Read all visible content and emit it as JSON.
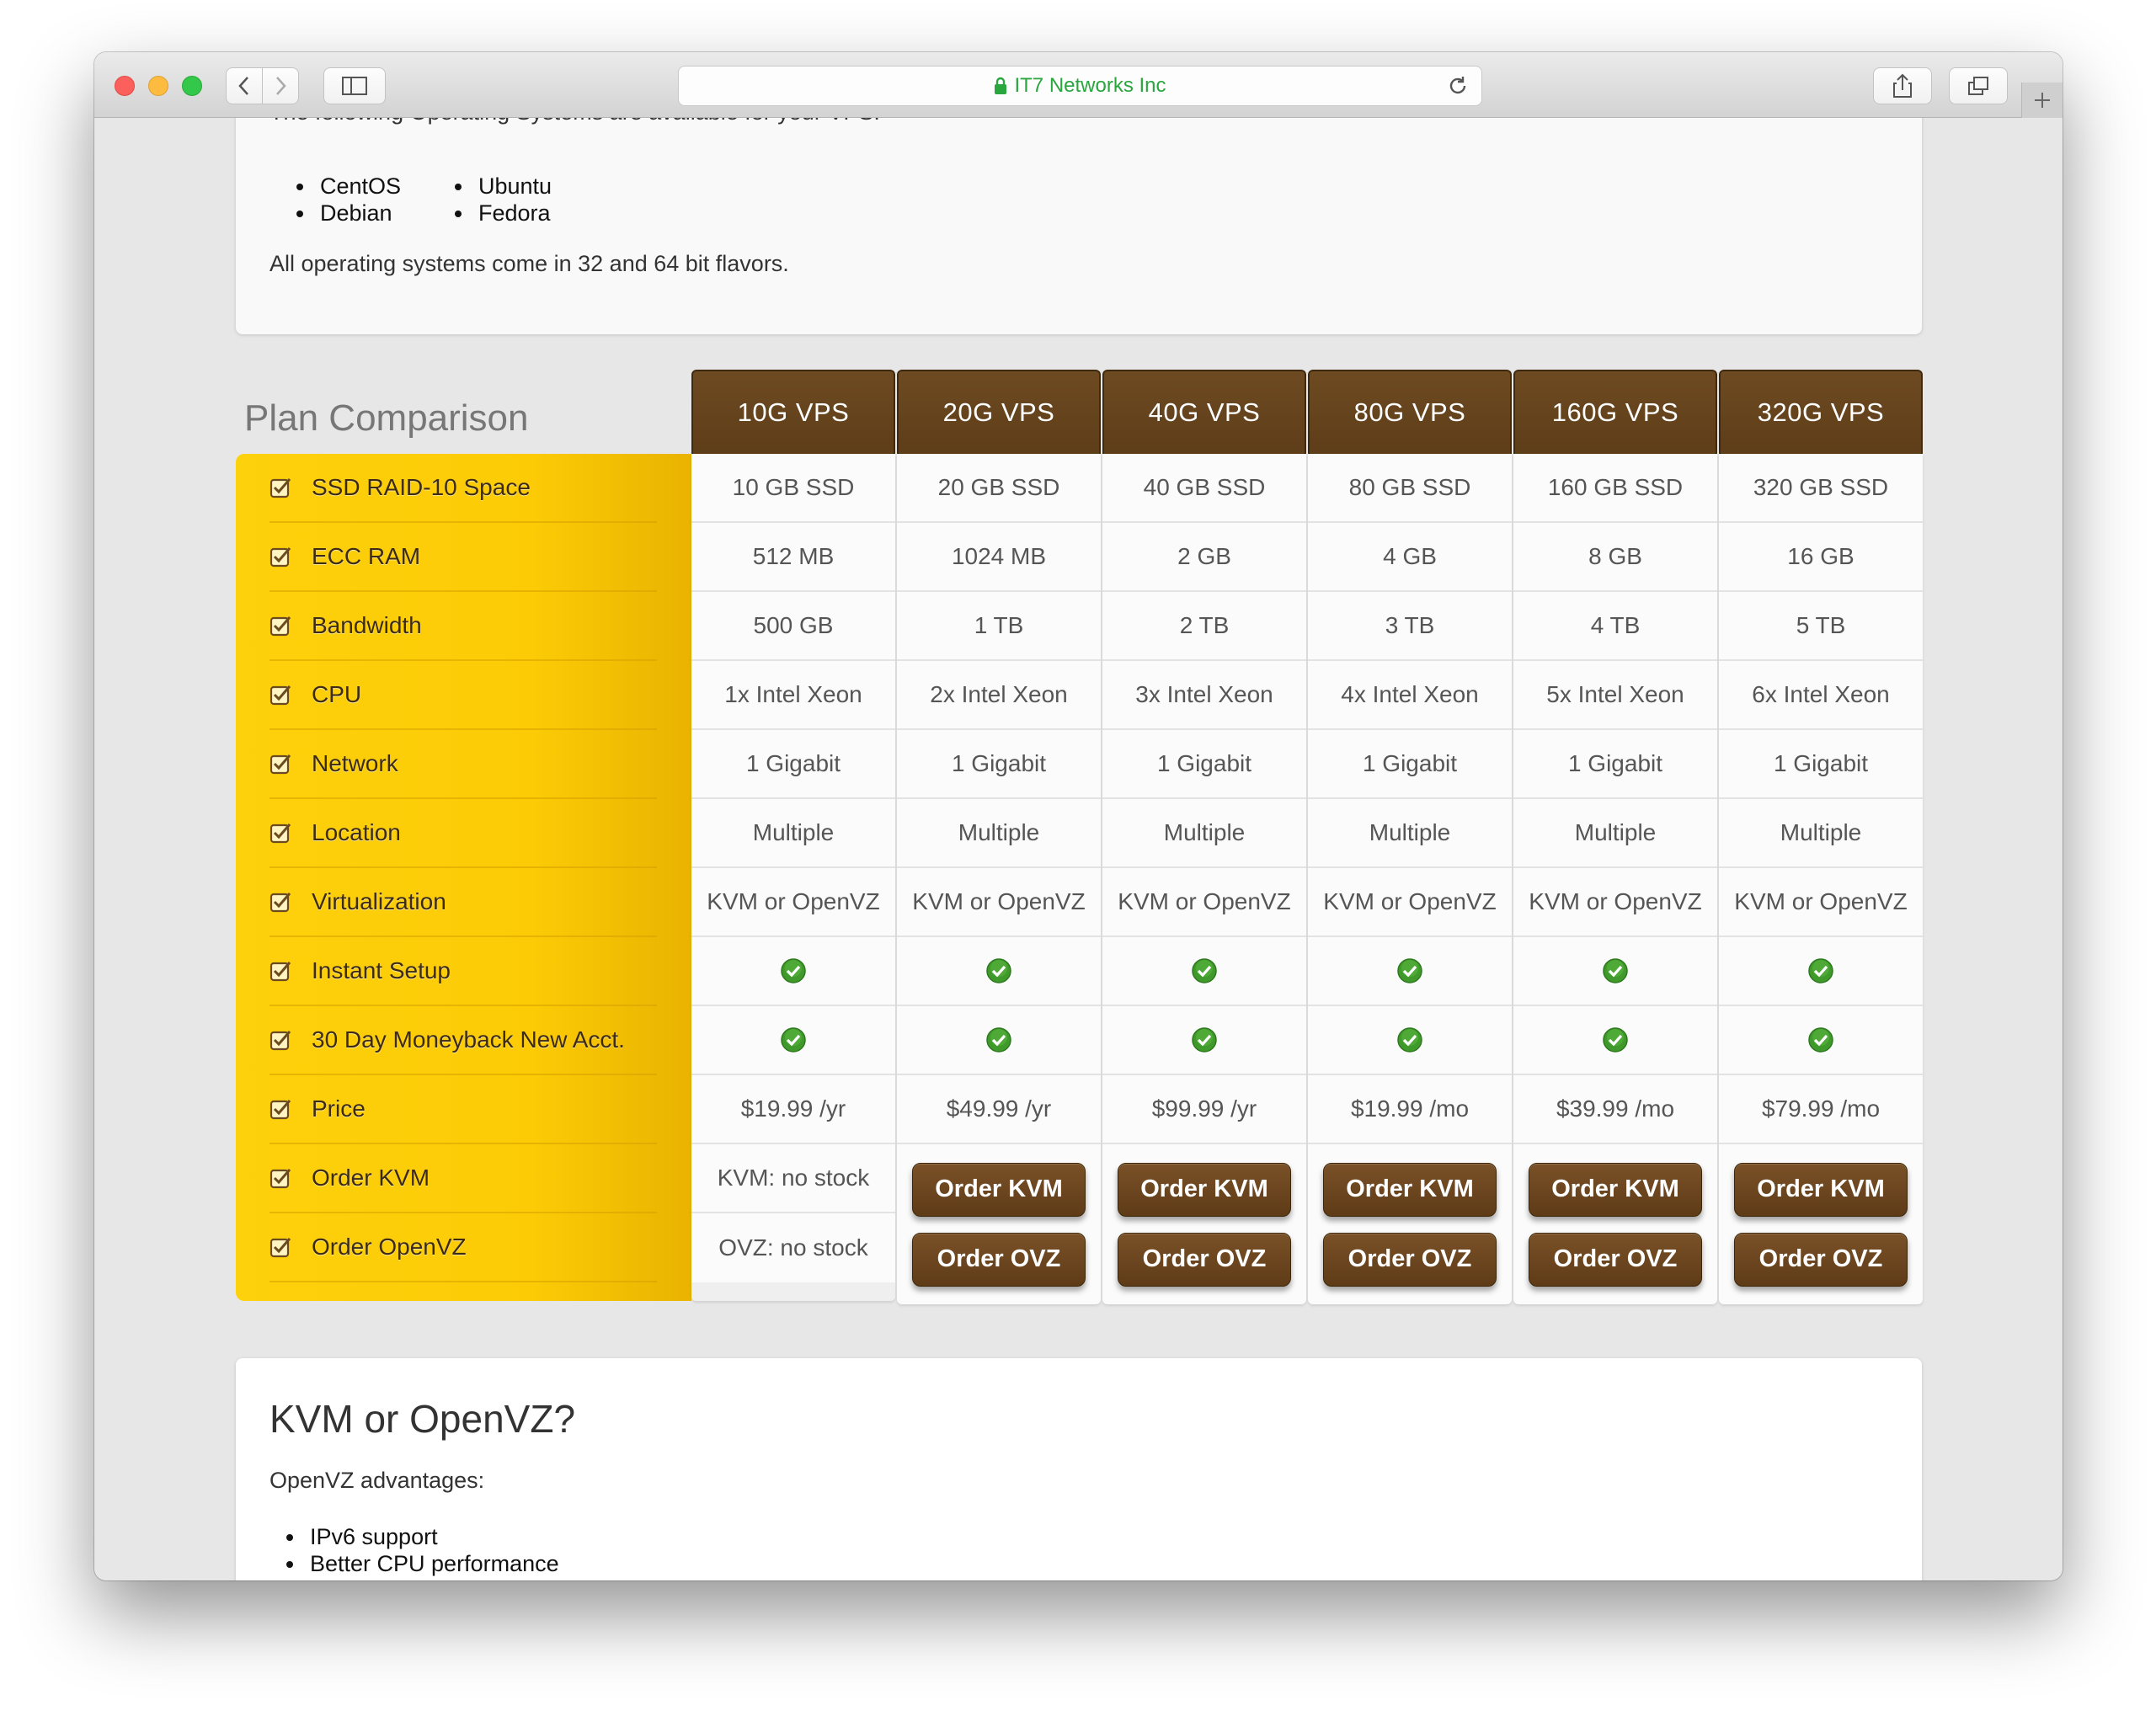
{
  "browser": {
    "url": "IT7 Networks Inc"
  },
  "os_section": {
    "intro": "The following Operating Systems are available for your VPS:",
    "column1": [
      "CentOS",
      "Debian"
    ],
    "column2": [
      "Ubuntu",
      "Fedora"
    ],
    "note": "All operating systems come in 32 and 64 bit flavors."
  },
  "comparison": {
    "title": "Plan Comparison",
    "features": [
      "SSD RAID-10 Space",
      "ECC RAM",
      "Bandwidth",
      "CPU",
      "Network",
      "Location",
      "Virtualization",
      "Instant Setup",
      "30 Day Moneyback New Acct.",
      "Price",
      "Order KVM",
      "Order OpenVZ"
    ],
    "plans": [
      {
        "name": "10G VPS",
        "values": [
          "10 GB SSD",
          "512 MB",
          "500 GB",
          "1x Intel Xeon",
          "1 Gigabit",
          "Multiple",
          "KVM or OpenVZ"
        ],
        "price": "$19.99 /yr",
        "kvm_stock": "KVM: no stock",
        "ovz_stock": "OVZ: no stock"
      },
      {
        "name": "20G VPS",
        "values": [
          "20 GB SSD",
          "1024 MB",
          "1 TB",
          "2x Intel Xeon",
          "1 Gigabit",
          "Multiple",
          "KVM or OpenVZ"
        ],
        "price": "$49.99 /yr",
        "order_kvm": "Order KVM",
        "order_ovz": "Order OVZ"
      },
      {
        "name": "40G VPS",
        "values": [
          "40 GB SSD",
          "2 GB",
          "2 TB",
          "3x Intel Xeon",
          "1 Gigabit",
          "Multiple",
          "KVM or OpenVZ"
        ],
        "price": "$99.99 /yr",
        "order_kvm": "Order KVM",
        "order_ovz": "Order OVZ"
      },
      {
        "name": "80G VPS",
        "values": [
          "80 GB SSD",
          "4 GB",
          "3 TB",
          "4x Intel Xeon",
          "1 Gigabit",
          "Multiple",
          "KVM or OpenVZ"
        ],
        "price": "$19.99 /mo",
        "order_kvm": "Order KVM",
        "order_ovz": "Order OVZ"
      },
      {
        "name": "160G VPS",
        "values": [
          "160 GB SSD",
          "8 GB",
          "4 TB",
          "5x Intel Xeon",
          "1 Gigabit",
          "Multiple",
          "KVM or OpenVZ"
        ],
        "price": "$39.99 /mo",
        "order_kvm": "Order KVM",
        "order_ovz": "Order OVZ"
      },
      {
        "name": "320G VPS",
        "values": [
          "320 GB SSD",
          "16 GB",
          "5 TB",
          "6x Intel Xeon",
          "1 Gigabit",
          "Multiple",
          "KVM or OpenVZ"
        ],
        "price": "$79.99 /mo",
        "order_kvm": "Order KVM",
        "order_ovz": "Order OVZ"
      }
    ]
  },
  "kvm_section": {
    "title": "KVM or OpenVZ?",
    "subtitle": "OpenVZ advantages:",
    "items": [
      "IPv6 support",
      "Better CPU performance"
    ]
  }
}
